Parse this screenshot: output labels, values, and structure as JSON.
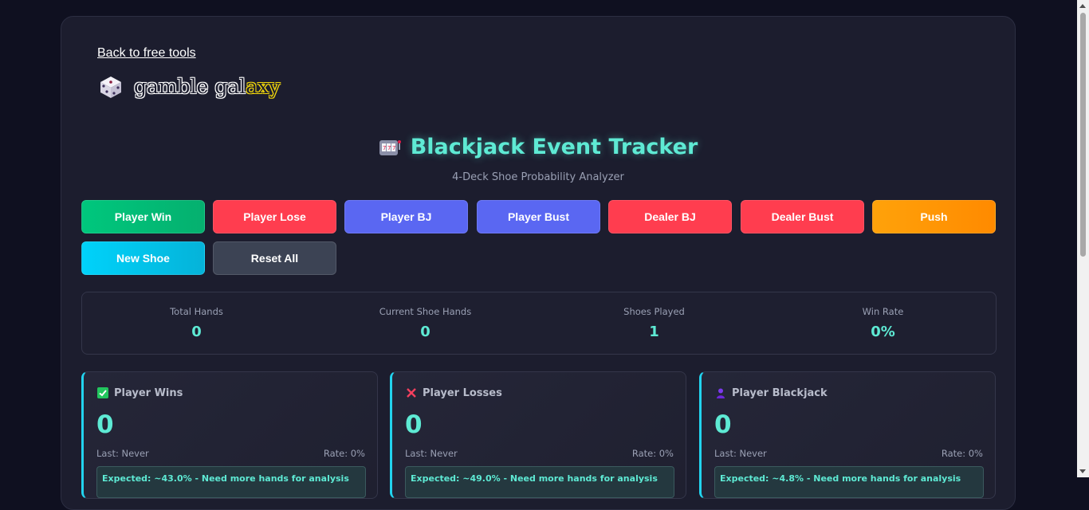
{
  "nav": {
    "back_link": "Back to free tools"
  },
  "logo": {
    "text_main": "gamble gal",
    "text_accent": "axy"
  },
  "header": {
    "title": "Blackjack Event Tracker",
    "subtitle": "4-Deck Shoe Probability Analyzer",
    "icon": "slot-machine-icon"
  },
  "buttons": [
    {
      "label": "Player Win",
      "color": "#00c77d"
    },
    {
      "label": "Player Lose",
      "color": "#ff3d4f"
    },
    {
      "label": "Player BJ",
      "color": "#5a67f2"
    },
    {
      "label": "Player Bust",
      "color": "#5a67f2"
    },
    {
      "label": "Dealer BJ",
      "color": "#ff3d4f"
    },
    {
      "label": "Dealer Bust",
      "color": "#ff3d4f"
    },
    {
      "label": "Push",
      "color": "#ff9a00"
    },
    {
      "label": "New Shoe",
      "color": "#00cbf2"
    },
    {
      "label": "Reset All",
      "color": "#3c4354"
    }
  ],
  "stats": [
    {
      "label": "Total Hands",
      "value": "0"
    },
    {
      "label": "Current Shoe Hands",
      "value": "0"
    },
    {
      "label": "Shoes Played",
      "value": "1"
    },
    {
      "label": "Win Rate",
      "value": "0%"
    }
  ],
  "events": [
    {
      "title": "Player Wins",
      "icon": "check-icon",
      "count": "0",
      "last": "Last: Never",
      "rate": "Rate: 0%",
      "expected": "Expected: ~43.0% - Need more hands for analysis"
    },
    {
      "title": "Player Losses",
      "icon": "cross-icon",
      "count": "0",
      "last": "Last: Never",
      "rate": "Rate: 0%",
      "expected": "Expected: ~49.0% - Need more hands for analysis"
    },
    {
      "title": "Player Blackjack",
      "icon": "person-icon",
      "count": "0",
      "last": "Last: Never",
      "rate": "Rate: 0%",
      "expected": "Expected: ~4.8% - Need more hands for analysis"
    }
  ]
}
